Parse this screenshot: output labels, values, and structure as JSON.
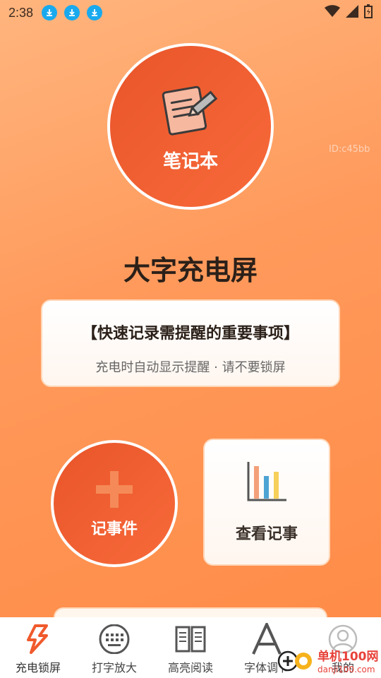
{
  "status_bar": {
    "time": "2:38",
    "download_icons": [
      "download-icon",
      "download-icon",
      "download-icon"
    ],
    "right_icons": [
      "wifi-icon",
      "signal-icon",
      "battery-charging-icon"
    ]
  },
  "notebook": {
    "label": "笔记本",
    "icon": "notepad-pencil-icon"
  },
  "watermark_id": "ID:c45bb",
  "app_title": "大字充电屏",
  "info_card": {
    "headline": "【快速记录需提醒的重要事项】",
    "subtitle": "充电时自动显示提醒 · 请不要锁屏"
  },
  "add_event": {
    "label": "记事件",
    "icon": "plus-icon"
  },
  "view_notes": {
    "label": "查看记事",
    "icon": "bar-chart-icon"
  },
  "tabs": [
    {
      "label": "充电锁屏",
      "icon": "lightning-icon",
      "active": true
    },
    {
      "label": "打字放大",
      "icon": "keyboard-icon",
      "active": false
    },
    {
      "label": "高亮阅读",
      "icon": "book-icon",
      "active": false
    },
    {
      "label": "字体调节",
      "icon": "font-a-icon",
      "active": false
    },
    {
      "label": "我的",
      "icon": "user-icon",
      "active": false
    }
  ],
  "watermark": {
    "cn": "单机100网",
    "en": "danji100.com"
  },
  "colors": {
    "accent": "#f05a2c",
    "background": "#ff9a5c",
    "card_border": "#ffd7b8",
    "download_blue": "#19a9ee"
  }
}
